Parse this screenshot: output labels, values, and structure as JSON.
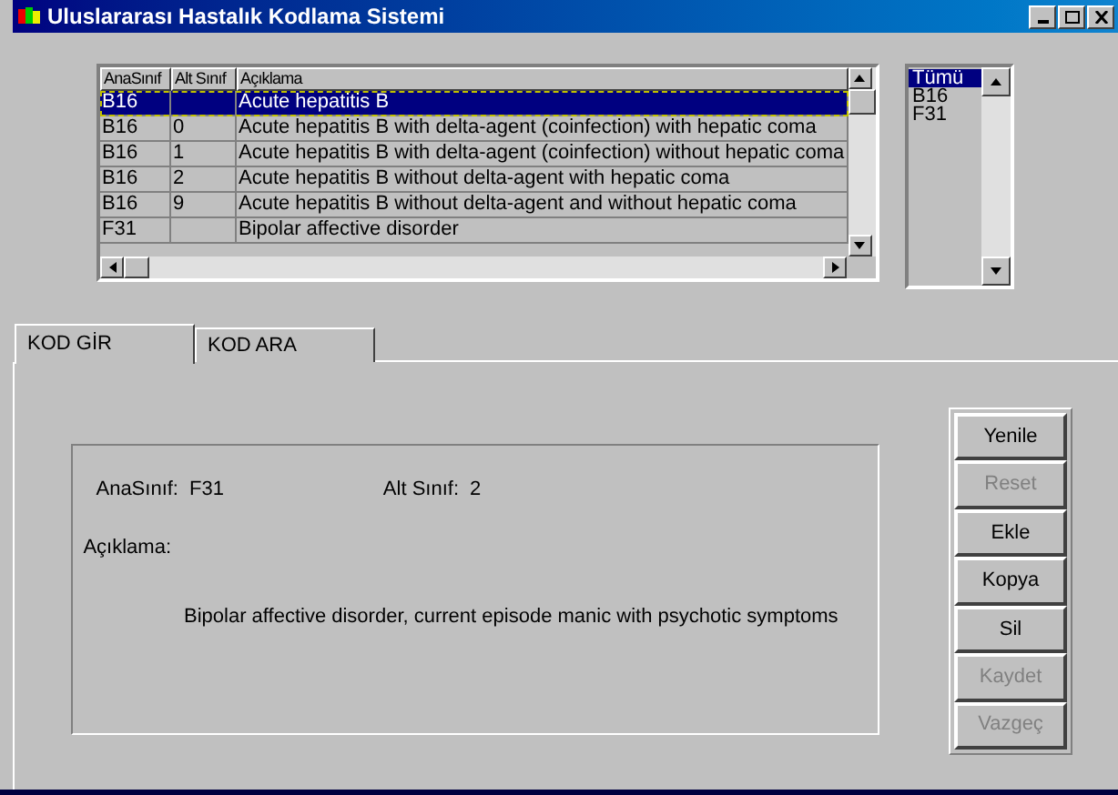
{
  "window": {
    "title": "Uluslararası Hastalık Kodlama Sistemi"
  },
  "table": {
    "columns": [
      "AnaSınıf",
      "Alt Sınıf",
      "Açıklama"
    ],
    "rows": [
      {
        "cells": [
          "B16",
          "",
          "Acute hepatitis B"
        ],
        "selected": true
      },
      {
        "cells": [
          "B16",
          "0",
          "Acute hepatitis B with delta-agent (coinfection) with hepatic coma"
        ],
        "selected": false
      },
      {
        "cells": [
          "B16",
          "1",
          "Acute hepatitis B with delta-agent (coinfection) without hepatic coma"
        ],
        "selected": false
      },
      {
        "cells": [
          "B16",
          "2",
          "Acute hepatitis B without delta-agent with hepatic coma"
        ],
        "selected": false
      },
      {
        "cells": [
          "B16",
          "9",
          "Acute hepatitis B without delta-agent and without hepatic coma"
        ],
        "selected": false
      },
      {
        "cells": [
          "F31",
          "",
          "Bipolar affective disorder"
        ],
        "selected": false
      }
    ]
  },
  "filter_list": {
    "items": [
      {
        "label": "Tümü",
        "selected": true
      },
      {
        "label": "B16",
        "selected": false
      },
      {
        "label": "F31",
        "selected": false
      }
    ]
  },
  "tabs": [
    {
      "label": "KOD GİR",
      "selected": true
    },
    {
      "label": "KOD ARA",
      "selected": false
    }
  ],
  "detail": {
    "main_class_label": "AnaSınıf:",
    "main_class_value": "F31",
    "sub_class_label": "Alt Sınıf:",
    "sub_class_value": "2",
    "description_label": "Açıklama:",
    "description_value": "Bipolar affective disorder, current episode manic with psychotic symptoms"
  },
  "buttons": [
    {
      "label": "Yenile",
      "disabled": false
    },
    {
      "label": "Reset",
      "disabled": true
    },
    {
      "label": "Ekle",
      "disabled": false
    },
    {
      "label": "Kopya",
      "disabled": false
    },
    {
      "label": "Sil",
      "disabled": false
    },
    {
      "label": "Kaydet",
      "disabled": true
    },
    {
      "label": "Vazgeç",
      "disabled": true
    }
  ]
}
